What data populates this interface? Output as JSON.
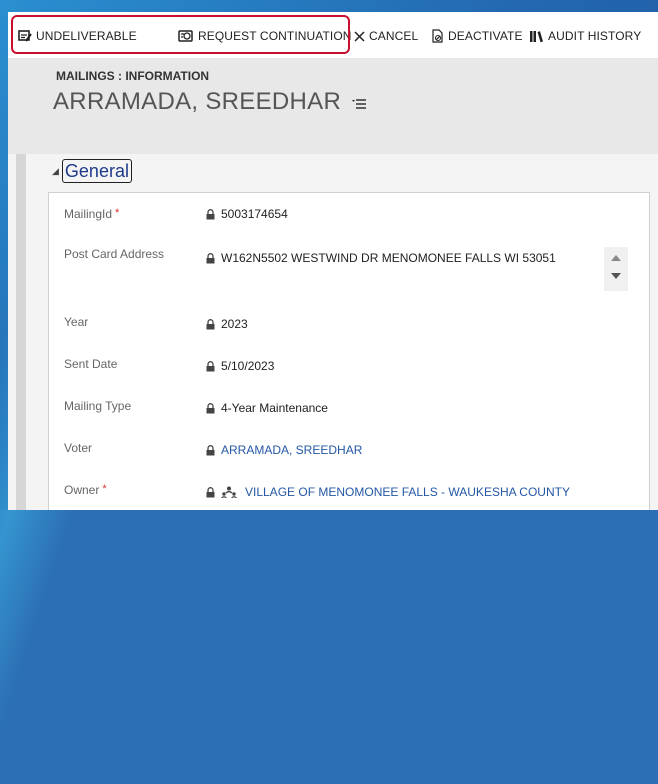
{
  "toolbar": {
    "buttons": [
      {
        "label": "UNDELIVERABLE",
        "icon": "undeliverable-icon"
      },
      {
        "label": "REQUEST CONTINUATION",
        "icon": "request-continuation-icon"
      },
      {
        "label": "CANCEL",
        "icon": "close-icon"
      },
      {
        "label": "DEACTIVATE",
        "icon": "deactivate-icon"
      },
      {
        "label": "AUDIT HISTORY",
        "icon": "audit-history-icon"
      }
    ],
    "highlight_color": "#c8102e"
  },
  "header": {
    "breadcrumb": "MAILINGS : INFORMATION",
    "title": "ARRAMADA, SREEDHAR"
  },
  "section": {
    "title": "General"
  },
  "fields": [
    {
      "label": "MailingId",
      "required": "*",
      "value": "5003174654"
    },
    {
      "label": "Post Card Address",
      "value": "W162N5502 WESTWIND DR MENOMONEE FALLS WI 53051"
    },
    {
      "label": "Year",
      "value": "2023"
    },
    {
      "label": "Sent Date",
      "value": "5/10/2023"
    },
    {
      "label": "Mailing Type",
      "value": "4-Year Maintenance"
    },
    {
      "label": "Voter",
      "value": "ARRAMADA, SREEDHAR"
    },
    {
      "label": "Owner",
      "required": "*",
      "value": "VILLAGE OF MENOMONEE FALLS - WAUKESHA COUNTY"
    }
  ],
  "colors": {
    "link": "#2457a6",
    "required": "#d32f2f",
    "section_title": "#1e3a8a"
  }
}
